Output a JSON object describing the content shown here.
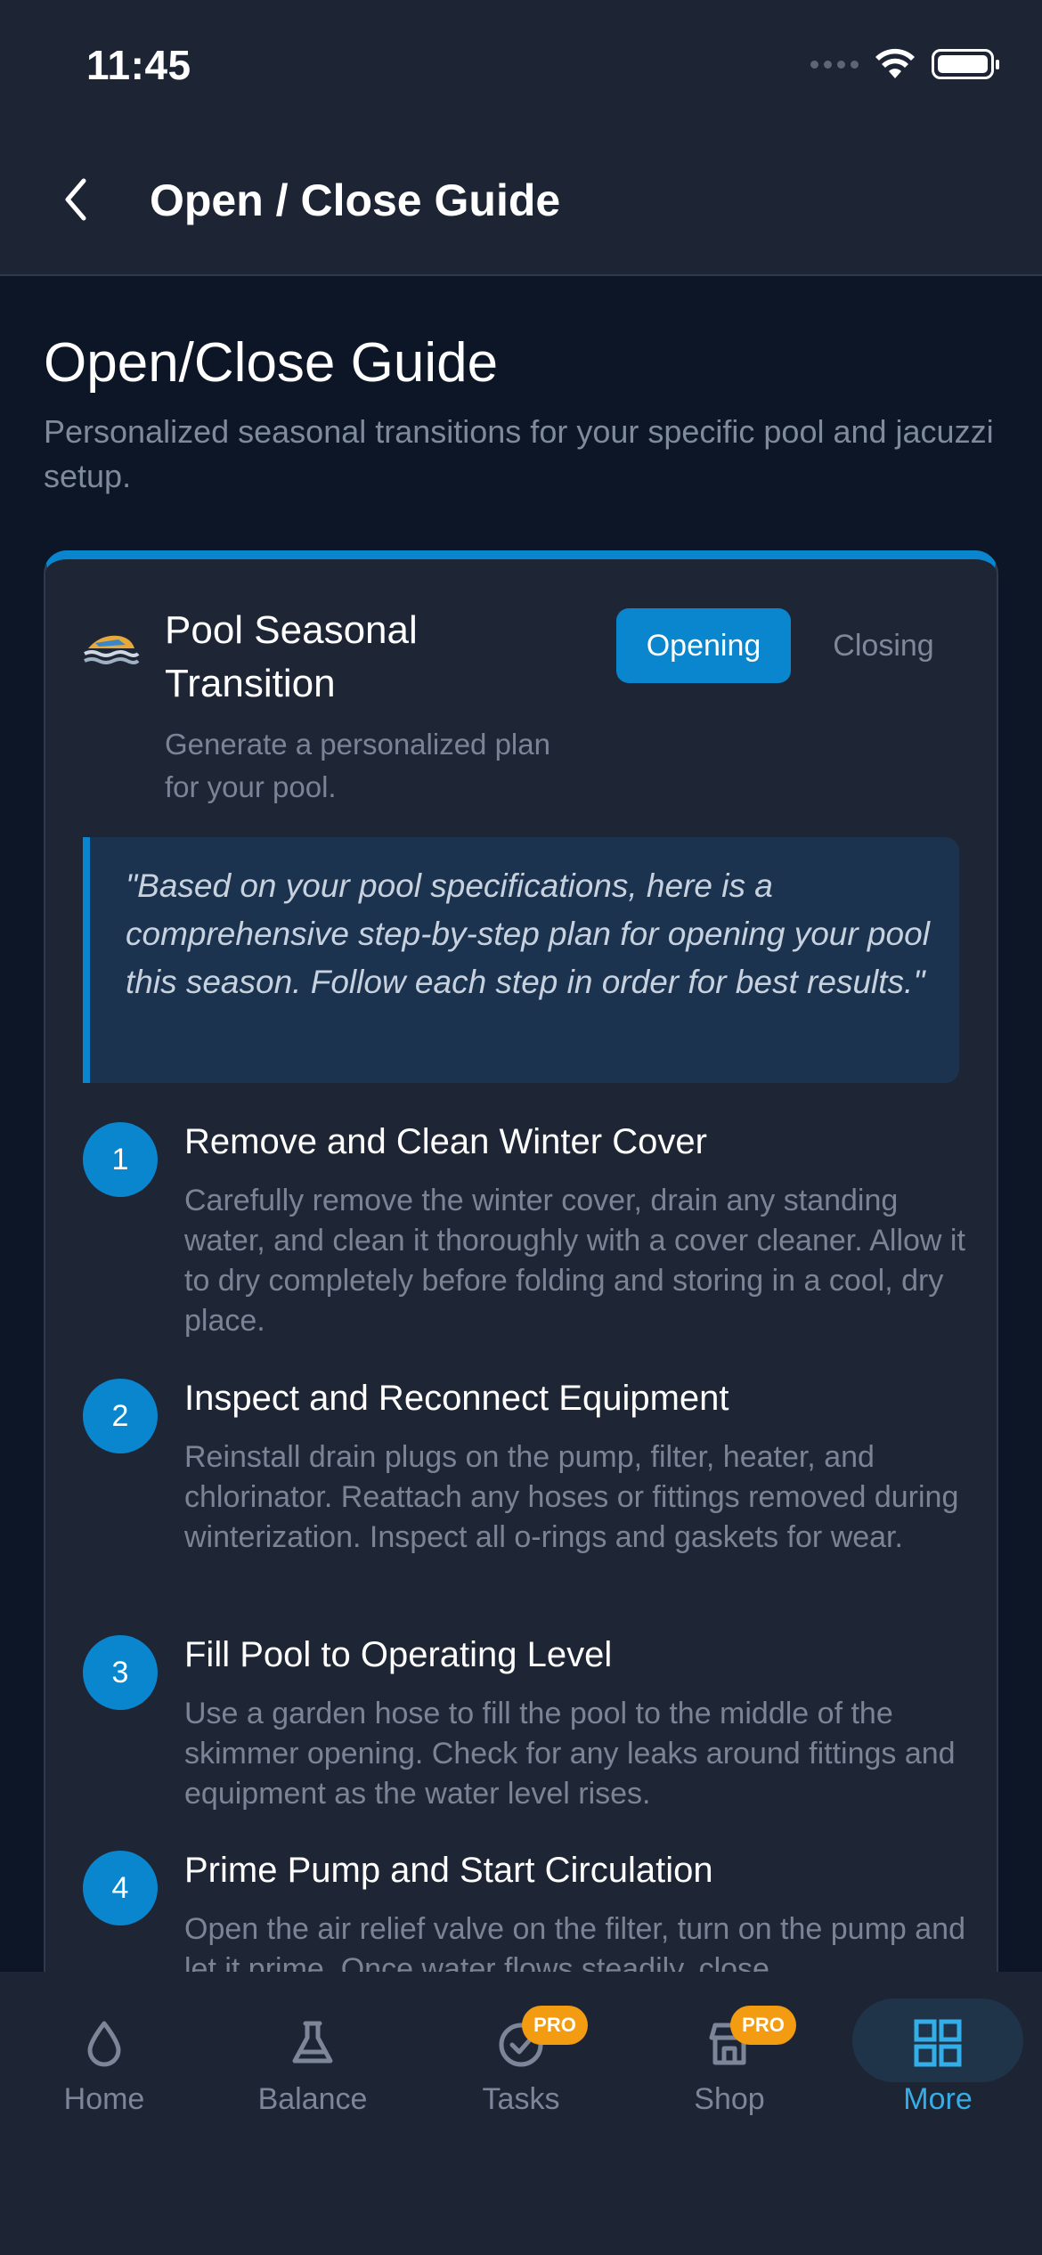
{
  "status_bar": {
    "time": "11:45"
  },
  "header": {
    "title": "Open / Close Guide"
  },
  "page": {
    "title": "Open/Close Guide",
    "subtitle": "Personalized seasonal transitions for your specific pool and jacuzzi setup."
  },
  "card": {
    "title": "Pool Seasonal Transition",
    "subtitle": "Generate a personalized plan for your pool.",
    "toggle": {
      "options": [
        "Opening",
        "Closing"
      ],
      "selected": "Opening"
    },
    "quote": "\"Based on your pool specifications, here is a comprehensive step-by-step plan for opening your pool this season. Follow each step in order for best results.\"",
    "steps": [
      {
        "number": "1",
        "title": "Remove and Clean Winter Cover",
        "description": "Carefully remove the winter cover, drain any standing water, and clean it thoroughly with a cover cleaner. Allow it to dry completely before folding and storing in a cool, dry place."
      },
      {
        "number": "2",
        "title": "Inspect and Reconnect Equipment",
        "description": "Reinstall drain plugs on the pump, filter, heater, and chlorinator. Reattach any hoses or fittings removed during winterization. Inspect all o-rings and gaskets for wear."
      },
      {
        "number": "3",
        "title": "Fill Pool to Operating Level",
        "description": "Use a garden hose to fill the pool to the middle of the skimmer opening. Check for any leaks around fittings and equipment as the water level rises."
      },
      {
        "number": "4",
        "title": "Prime Pump and Start Circulation",
        "description": "Open the air relief valve on the filter, turn on the pump and let it prime. Once water flows steadily, close"
      }
    ]
  },
  "bottom_nav": {
    "items": [
      {
        "label": "Home",
        "icon": "drop-icon",
        "active": false
      },
      {
        "label": "Balance",
        "icon": "flask-icon",
        "active": false
      },
      {
        "label": "Tasks",
        "icon": "check-circle-icon",
        "active": false,
        "badge": "PRO"
      },
      {
        "label": "Shop",
        "icon": "store-icon",
        "active": false,
        "badge": "PRO"
      },
      {
        "label": "More",
        "icon": "grid-icon",
        "active": true
      }
    ],
    "colors": {
      "active": "#33aee8",
      "inactive": "#7c8698",
      "badge": "#f39c12"
    }
  },
  "colors": {
    "accent": "#0a86cf",
    "background": "#0d1626",
    "card": "#1e2636"
  }
}
